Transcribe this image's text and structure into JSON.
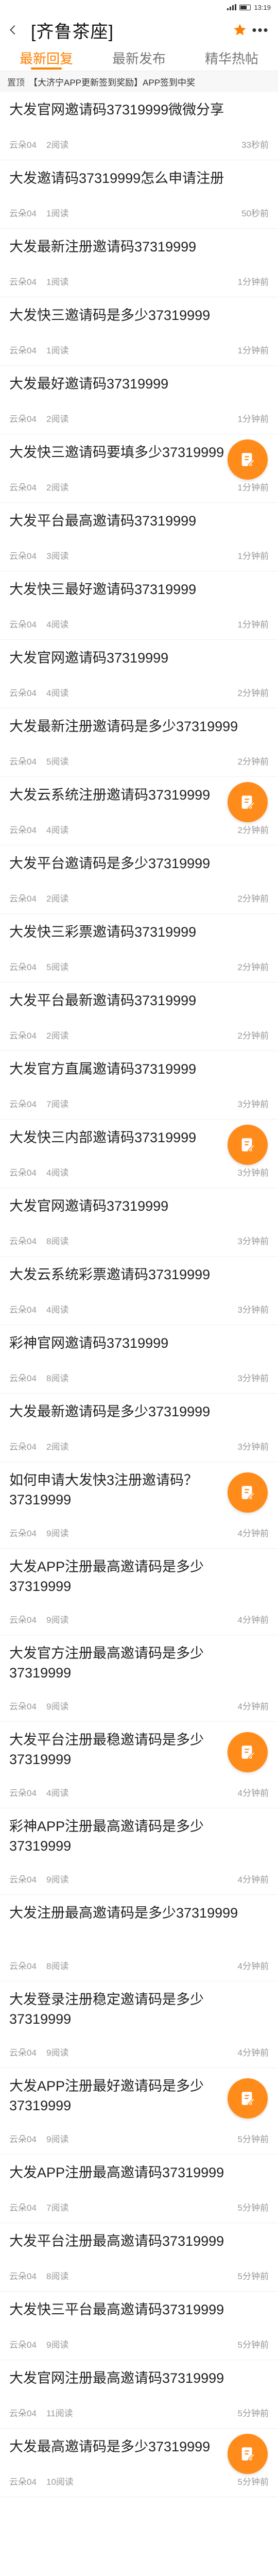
{
  "status": {
    "time": "13:19"
  },
  "header": {
    "title": "[齐鲁茶座]"
  },
  "tabs": [
    {
      "label": "最新回复"
    },
    {
      "label": "最新发布"
    },
    {
      "label": "精华热帖"
    }
  ],
  "notice": {
    "tag": "置顶",
    "text": "【大济宁APP更新签到奖励】APP签到中奖"
  },
  "posts": [
    {
      "title": "大发官网邀请码37319999微微分享",
      "author": "云朵04",
      "reads": "2阅读",
      "time": "33秒前"
    },
    {
      "title": "大发邀请码37319999怎么申请注册",
      "author": "云朵04",
      "reads": "1阅读",
      "time": "50秒前"
    },
    {
      "title": "大发最新注册邀请码37319999",
      "author": "云朵04",
      "reads": "1阅读",
      "time": "1分钟前"
    },
    {
      "title": "大发快三邀请码是多少37319999",
      "author": "云朵04",
      "reads": "1阅读",
      "time": "1分钟前"
    },
    {
      "title": "大发最好邀请码37319999",
      "author": "云朵04",
      "reads": "2阅读",
      "time": "1分钟前"
    },
    {
      "title": "大发快三邀请码要填多少37319999",
      "author": "云朵04",
      "reads": "2阅读",
      "time": "1分钟前"
    },
    {
      "title": "大发平台最高邀请码37319999",
      "author": "云朵04",
      "reads": "3阅读",
      "time": "1分钟前"
    },
    {
      "title": "大发快三最好邀请码37319999",
      "author": "云朵04",
      "reads": "4阅读",
      "time": "1分钟前"
    },
    {
      "title": "大发官网邀请码37319999",
      "author": "云朵04",
      "reads": "4阅读",
      "time": "2分钟前"
    },
    {
      "title": "大发最新注册邀请码是多少37319999",
      "author": "云朵04",
      "reads": "5阅读",
      "time": "2分钟前"
    },
    {
      "title": "大发云系统注册邀请码37319999",
      "author": "云朵04",
      "reads": "4阅读",
      "time": "2分钟前"
    },
    {
      "title": "大发平台邀请码是多少37319999",
      "author": "云朵04",
      "reads": "2阅读",
      "time": "2分钟前"
    },
    {
      "title": "大发快三彩票邀请码37319999",
      "author": "云朵04",
      "reads": "5阅读",
      "time": "2分钟前"
    },
    {
      "title": "大发平台最新邀请码37319999",
      "author": "云朵04",
      "reads": "2阅读",
      "time": "2分钟前"
    },
    {
      "title": "大发官方直属邀请码37319999",
      "author": "云朵04",
      "reads": "7阅读",
      "time": "3分钟前"
    },
    {
      "title": "大发快三内部邀请码37319999",
      "author": "云朵04",
      "reads": "4阅读",
      "time": "3分钟前"
    },
    {
      "title": "大发官网邀请码37319999",
      "author": "云朵04",
      "reads": "8阅读",
      "time": "3分钟前"
    },
    {
      "title": "大发云系统彩票邀请码37319999",
      "author": "云朵04",
      "reads": "4阅读",
      "time": "3分钟前"
    },
    {
      "title": "彩神官网邀请码37319999",
      "author": "云朵04",
      "reads": "8阅读",
      "time": "3分钟前"
    },
    {
      "title": "大发最新邀请码是多少37319999",
      "author": "云朵04",
      "reads": "2阅读",
      "time": "3分钟前"
    },
    {
      "title": "如何申请大发快3注册邀请码？37319999",
      "author": "云朵04",
      "reads": "9阅读",
      "time": "4分钟前"
    },
    {
      "title": "大发APP注册最高邀请码是多少37319999",
      "author": "云朵04",
      "reads": "9阅读",
      "time": "4分钟前"
    },
    {
      "title": "大发官方注册最高邀请码是多少37319999",
      "author": "云朵04",
      "reads": "9阅读",
      "time": "4分钟前"
    },
    {
      "title": "大发平台注册最稳邀请码是多少37319999",
      "author": "云朵04",
      "reads": "4阅读",
      "time": "4分钟前"
    },
    {
      "title": "彩神APP注册最高邀请码是多少37319999",
      "author": "云朵04",
      "reads": "9阅读",
      "time": "4分钟前"
    },
    {
      "title": "大发注册最高邀请码是多少37319999",
      "author": "云朵04",
      "reads": "8阅读",
      "time": "4分钟前"
    },
    {
      "title": "大发登录注册稳定邀请码是多少37319999",
      "author": "云朵04",
      "reads": "9阅读",
      "time": "4分钟前"
    },
    {
      "title": "大发APP注册最好邀请码是多少37319999",
      "author": "云朵04",
      "reads": "9阅读",
      "time": "5分钟前"
    },
    {
      "title": "大发APP注册最高邀请码37319999",
      "author": "云朵04",
      "reads": "7阅读",
      "time": "5分钟前"
    },
    {
      "title": "大发平台注册最高邀请码37319999",
      "author": "云朵04",
      "reads": "8阅读",
      "time": "5分钟前"
    },
    {
      "title": "大发快三平台最高邀请码37319999",
      "author": "云朵04",
      "reads": "9阅读",
      "time": "5分钟前"
    },
    {
      "title": "大发官网注册最高邀请码37319999",
      "author": "云朵04",
      "reads": "11阅读",
      "time": "5分钟前"
    },
    {
      "title": "大发最高邀请码是多少37319999",
      "author": "云朵04",
      "reads": "10阅读",
      "time": "5分钟前"
    }
  ],
  "icons": {
    "back": "back-arrow-icon",
    "star": "star-icon",
    "more": "more-icon",
    "fab": "compose-icon"
  },
  "colors": {
    "accent": "#ff7f00",
    "fab": "#ff8b1a"
  }
}
